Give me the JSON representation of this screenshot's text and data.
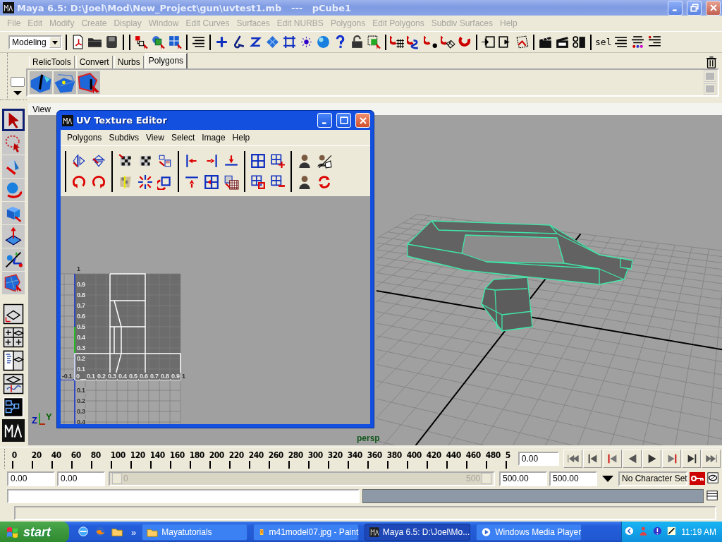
{
  "window": {
    "title": "Maya 6.5: D:\\Joel\\Mod\\New_Project\\gun\\uvtest1.mb   ---   pCube1"
  },
  "menu": [
    "File",
    "Edit",
    "Modify",
    "Create",
    "Display",
    "Window",
    "Edit Curves",
    "Surfaces",
    "Edit NURBS",
    "Polygons",
    "Edit Polygons",
    "Subdiv Surfaces",
    "Help"
  ],
  "status_line": {
    "menu_set": "Modeling",
    "selection_menu": "sel"
  },
  "shelf": {
    "tabs": [
      {
        "label": "RelicTools",
        "selected": false
      },
      {
        "label": "Convert",
        "selected": false
      },
      {
        "label": "Nurbs",
        "selected": false
      },
      {
        "label": "Polygons",
        "selected": true
      }
    ]
  },
  "toolbox": {
    "tools": [
      {
        "selected": true
      },
      {
        "selected": false
      },
      {
        "selected": false
      },
      {
        "selected": false
      },
      {
        "selected": false
      },
      {
        "selected": false
      },
      {
        "selected": false
      },
      {
        "selected": false
      }
    ]
  },
  "viewport": {
    "menu": [
      "View"
    ],
    "camera": "persp",
    "axis": {
      "y": "Y",
      "z": "Z"
    }
  },
  "uv_editor": {
    "title": "UV Texture Editor",
    "menu": [
      "Polygons",
      "Subdivs",
      "View",
      "Select",
      "Image",
      "Help"
    ],
    "v_labels": [
      "1",
      "0.9",
      "0.8",
      "0.7",
      "0.6",
      "0.5",
      "0.4",
      "0.3",
      "0.2",
      "0.1"
    ],
    "u_labels": [
      "-0.1",
      "0",
      "0.1",
      "0.2",
      "0.3",
      "0.4",
      "0.5",
      "0.6",
      "0.7",
      "0.8",
      "0.9",
      "1"
    ],
    "negative_v_labels": [
      "0.1",
      "0.2",
      "0.3",
      "0.4"
    ]
  },
  "time_slider": {
    "ticks": [
      "0",
      "20",
      "40",
      "60",
      "80",
      "100",
      "120",
      "140",
      "160",
      "180",
      "200",
      "220",
      "240",
      "260",
      "280",
      "300",
      "320",
      "340",
      "360",
      "380",
      "400",
      "420",
      "440",
      "460",
      "480",
      "5"
    ],
    "current_time": "0.00"
  },
  "range_slider": {
    "level": 1,
    "start": "0.00",
    "playback_start": "0.00",
    "slider_start": "0",
    "slider_end": "500",
    "playback_end": "500.00",
    "end": "500.00",
    "character_set": "No Character Set"
  },
  "taskbar": {
    "start": "start",
    "more": "»",
    "tasks": [
      {
        "label": "Mayatutorials",
        "selected": false
      },
      {
        "label": "m41model07.jpg - Paint",
        "selected": false
      },
      {
        "label": "Maya 6.5: D:\\Joel\\Mo...",
        "selected": true
      },
      {
        "label": "Windows Media Player",
        "selected": false
      }
    ],
    "clock": "11:19 AM"
  }
}
